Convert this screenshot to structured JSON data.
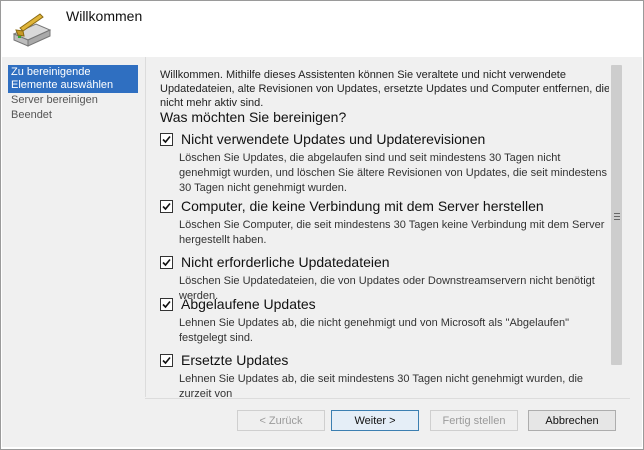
{
  "header": {
    "title": "Willkommen",
    "icon": "server-cleanup-wizard-icon"
  },
  "nav": {
    "items": [
      {
        "label": "Zu bereinigende Elemente auswählen",
        "active": true
      },
      {
        "label": "Server bereinigen",
        "active": false
      },
      {
        "label": "Beendet",
        "active": false
      }
    ]
  },
  "content": {
    "intro": "Willkommen. Mithilfe dieses Assistenten können Sie veraltete und nicht verwendete Updatedateien, alte Revisionen von Updates, ersetzte Updates und Computer entfernen, die nicht mehr aktiv sind.",
    "question": "Was möchten Sie bereinigen?",
    "options": [
      {
        "title": "Nicht verwendete Updates und Updaterevisionen",
        "checked": true,
        "desc": "Löschen Sie Updates, die abgelaufen sind und seit mindestens 30 Tagen nicht genehmigt wurden, und löschen Sie ältere Revisionen von Updates, die seit mindestens 30 Tagen nicht genehmigt wurden."
      },
      {
        "title": "Computer, die keine Verbindung mit dem Server herstellen",
        "checked": true,
        "desc": "Löschen Sie Computer, die seit mindestens 30 Tagen keine Verbindung mit dem Server hergestellt haben."
      },
      {
        "title": "Nicht erforderliche Updatedateien",
        "checked": true,
        "desc": "Löschen Sie Updatedateien, die von Updates oder Downstreamservern nicht benötigt werden."
      },
      {
        "title": "Abgelaufene Updates",
        "checked": true,
        "desc": "Lehnen Sie Updates ab, die nicht genehmigt und von Microsoft als \"Abgelaufen\" festgelegt sind."
      },
      {
        "title": "Ersetzte Updates",
        "checked": true,
        "desc": "Lehnen Sie Updates ab, die seit mindestens 30 Tagen nicht genehmigt wurden, die zurzeit von"
      }
    ]
  },
  "buttons": {
    "back": "< Zurück",
    "next": "Weiter >",
    "finish": "Fertig stellen",
    "cancel": "Abbrechen"
  }
}
